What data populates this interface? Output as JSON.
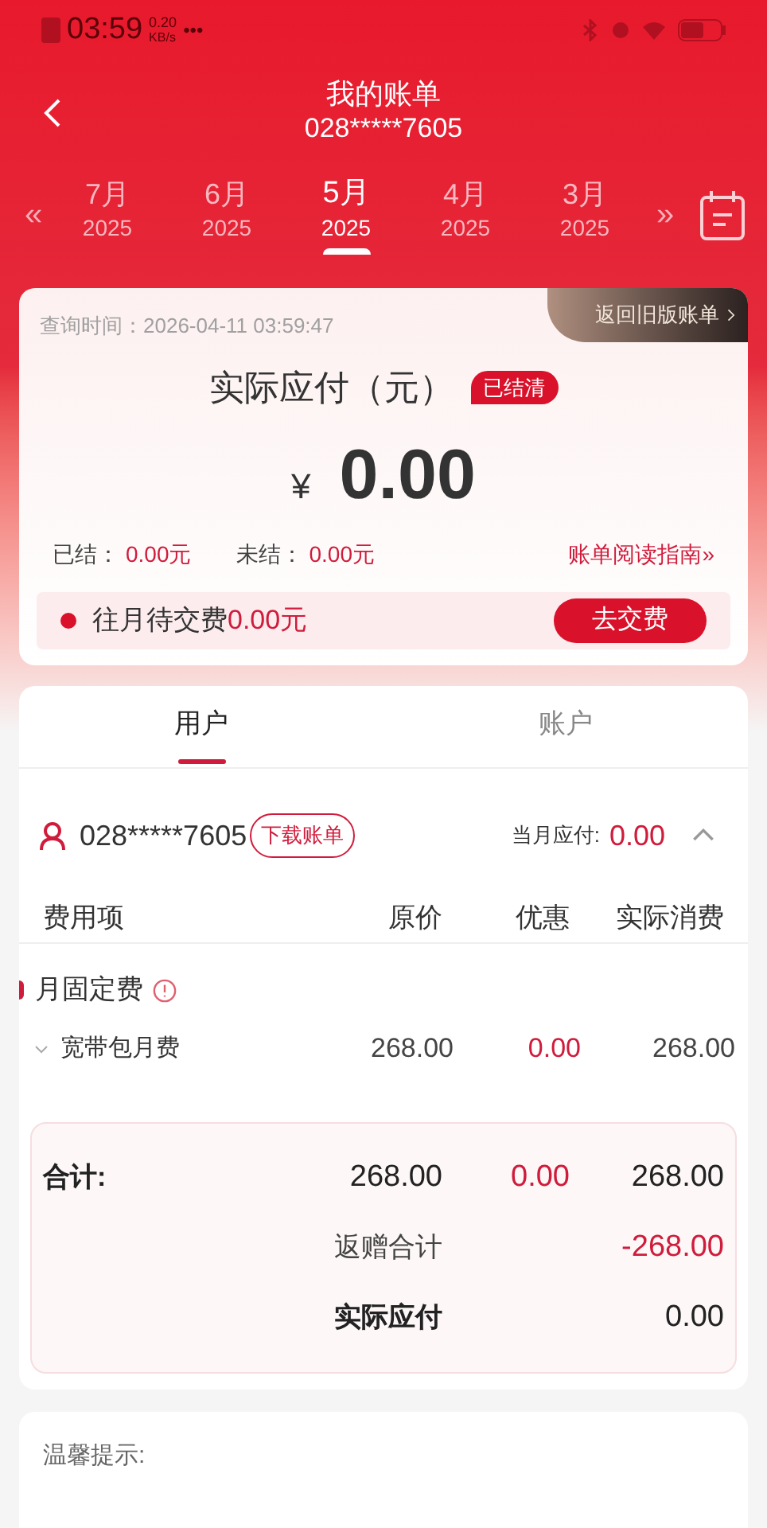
{
  "status_bar": {
    "time": "03:59",
    "speed_value": "0.20",
    "speed_unit": "KB/s",
    "more": "•••"
  },
  "header": {
    "title": "我的账单",
    "subtitle": "028*****7605"
  },
  "months": [
    {
      "month": "7月",
      "year": "2025",
      "selected": false
    },
    {
      "month": "6月",
      "year": "2025",
      "selected": false
    },
    {
      "month": "5月",
      "year": "2025",
      "selected": true
    },
    {
      "month": "4月",
      "year": "2025",
      "selected": false
    },
    {
      "month": "3月",
      "year": "2025",
      "selected": false
    }
  ],
  "month_prev": "«",
  "month_next": "»",
  "summary": {
    "query_time": "查询时间：2026-04-11 03:59:47",
    "old_version_link": "返回旧版账单",
    "heading": "实际应付（元）",
    "status_badge": "已结清",
    "currency": "¥",
    "amount": "0.00",
    "settled_label": "已结：",
    "settled_value": "0.00元",
    "unsettled_label": "未结：",
    "unsettled_value": "0.00元",
    "guide_link": "账单阅读指南»",
    "overdue_label": "往月待交费",
    "overdue_value": "0.00元",
    "pay_button": "去交费"
  },
  "tabs": [
    {
      "label": "用户",
      "selected": true
    },
    {
      "label": "账户",
      "selected": false
    }
  ],
  "user": {
    "number": "028*****7605",
    "download_button": "下载账单",
    "due_label": "当月应付:",
    "due_value": "0.00",
    "expanded": true
  },
  "table": {
    "columns": [
      "费用项",
      "原价",
      "优惠",
      "实际消费"
    ],
    "groups": [
      {
        "name": "月固定费",
        "rows": [
          {
            "name": "宽带包月费",
            "original": "268.00",
            "discount": "0.00",
            "actual": "268.00",
            "expanded": false
          }
        ]
      }
    ]
  },
  "totals": {
    "label": "合计:",
    "original": "268.00",
    "discount": "0.00",
    "actual": "268.00",
    "rebate_label": "返赠合计",
    "rebate_value": "-268.00",
    "payable_label": "实际应付",
    "payable_value": "0.00"
  },
  "tips": {
    "title": "温馨提示:"
  }
}
